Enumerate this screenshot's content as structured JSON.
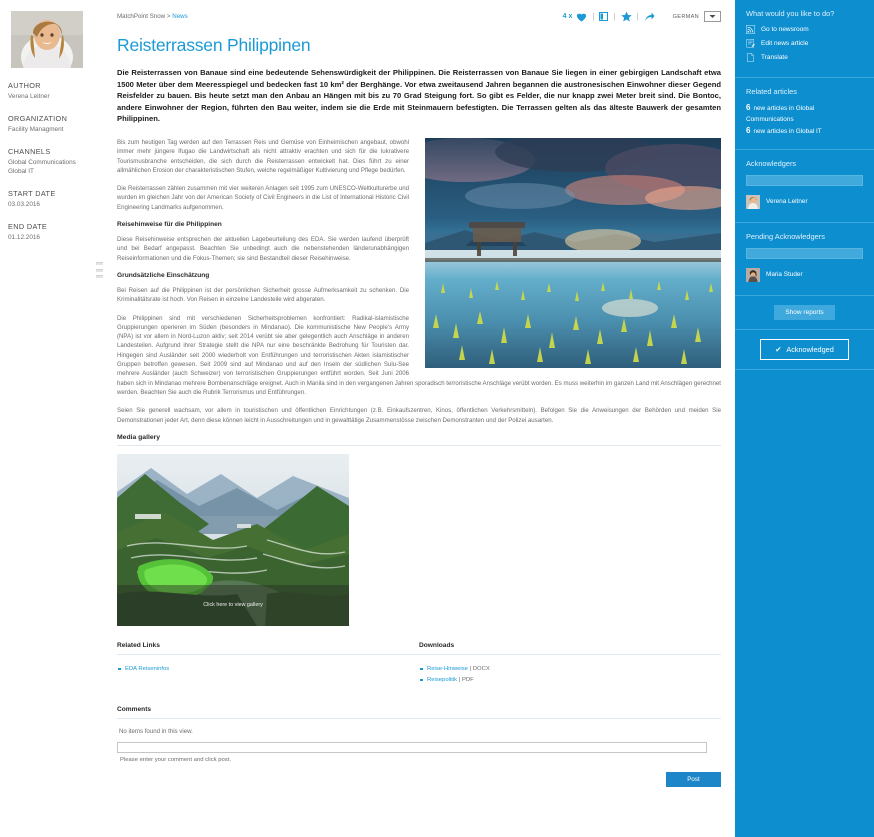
{
  "breadcrumb": {
    "root": "MatchPoint Snow",
    "separator": ">",
    "current": "News"
  },
  "toolbar": {
    "like_count": "4 x",
    "heart_icon": "heart-icon",
    "panel_icon": "panel-icon",
    "star_icon": "star-icon",
    "share_icon": "share-arrow-icon",
    "language_label": "GERMAN",
    "language_selected": "GERMAN"
  },
  "article": {
    "title": "Reisterrassen Philippinen",
    "lead": "Die Reisterrassen von Banaue sind eine bedeutende Sehenswürdigkeit der Philippinen. Die Reisterrassen von Banaue Sie liegen in einer gebirgigen Landschaft etwa 1500 Meter über dem Meeresspiegel und bedecken fast 10 km² der Berghänge. Vor etwa zweitausend Jahren begannen die austronesischen Einwohner dieser Gegend Reisfelder zu bauen. Bis heute setzt man den Anbau an Hängen mit bis zu 70 Grad Steigung fort. So gibt es Felder, die nur knapp zwei Meter breit sind. Die Bontoc, andere Einwohner der Region, führten den Bau weiter, indem sie die Erde mit Steinmauern befestigten. Die Terrassen gelten als das älteste Bauwerk der gesamten Philippinen.",
    "paragraphs": [
      "Bis zum heutigen Tag werden auf den Terrassen Reis und Gemüse von Einheimischen angebaut, obwohl immer mehr jüngere Ifugao die Landwirtschaft als nicht attraktiv erachten und sich für die lukrativere Tourismusbranche entscheiden, die sich durch die Reisterrassen entwickelt hat. Dies führt zu einer allmählichen Erosion der charakteristischen Stufen, welche regelmäßiger Kultivierung und Pflege bedürfen.",
      "Die Reisterrassen zählen zusammen mit vier weiteren Anlagen seit 1995 zum UNESCO-Weltkulturerbe und wurden im gleichen Jahr von der American Society of Civil Engineers in die List of International Historic Civil Engineering Landmarks aufgenommen."
    ],
    "heading_travel": "Reisehinweise für die Philippinen",
    "paragraph_travel": "Diese Reisehinweise entsprechen der aktuellen Lagebeurteilung des EDA. Sie werden laufend überprüft und bei Bedarf angepasst. Beachten Sie unbedingt auch die nebenstehenden länderunabhängigen Reiseinformationen und die Fokus-Themen; sie sind Bestandteil dieser Reisehinweise.",
    "heading_assessment": "Grundsätzliche Einschätzung",
    "paragraph_assessment": "Bei Reisen auf die Philippinen ist der persönlichen Sicherheit grosse Aufmerksamkeit zu schenken. Die Kriminalitätsrate ist hoch. Von Reisen in einzelne Landesteile wird abgeraten.",
    "paragraph_security": "Die Philippinen sind mit verschiedenen Sicherheitsproblemen konfrontiert: Radikal-islamistische Gruppierungen operieren im Süden (besonders in Mindanao). Die kommunistische New People's Army (NPA) ist vor allem in Nord-Luzon aktiv; seit 2014 verübt sie aber gelegentlich auch Anschläge in anderen Landesteilen. Aufgrund ihrer Strategie stellt die NPA nur eine beschränkte Bedrohung für Touristen dar. Hingegen sind Ausländer seit 2000 wiederholt von Entführungen und terroristischen Akten islamistischer Gruppen betroffen gewesen. Seit 2009 sind auf Mindanao und auf den Inseln der südlichen Sulu-See mehrere Ausländer (auch Schweizer) von terroristischen Gruppierungen entführt worden. Seit Juni 2006 haben sich in Mindanao mehrere Bombenanschläge ereignet. Auch in Manila sind in den vergangenen Jahren sporadisch terroristische Anschläge verübt worden. Es muss weiterhin im ganzen Land mit Anschlägen gerechnet werden. Beachten Sie auch die Rubrik Terrorismus und Entführungen.",
    "paragraph_final": "Seien Sie generell wachsam, vor allem in touristischen und öffentlichen Einrichtungen (z.B. Einkaufszentren, Kinos, öffentlichen Verkehrsmitteln). Befolgen Sie die Anweisungen der Behörden und meiden Sie Demonstrationen jeder Art, denn diese können leicht in Ausschreitungen und in gewalttätige Zusammenstösse zwischen Demonstranten und der Polizei ausarten."
  },
  "meta": {
    "author_label": "AUTHOR",
    "author_value": "Verena Leitner",
    "organization_label": "ORGANIZATION",
    "organization_value": "Facility Managment",
    "channels_label": "CHANNELS",
    "channels_values": [
      "Global Communications",
      "Global IT"
    ],
    "start_date_label": "START DATE",
    "start_date_value": "03.03.2016",
    "end_date_label": "END DATE",
    "end_date_value": "01.12.2016"
  },
  "gallery": {
    "heading": "Media gallery",
    "caption": "Click here to view gallery"
  },
  "related_links": {
    "heading": "Related Links",
    "items": [
      {
        "label": "EDA Reiseninfos"
      }
    ]
  },
  "downloads": {
    "heading": "Downloads",
    "items": [
      {
        "label": "Reise-Hinweise",
        "sep": " | ",
        "type": "DOCX"
      },
      {
        "label": "Reisepolitik",
        "sep": " | ",
        "type": "PDF"
      }
    ]
  },
  "comments": {
    "heading": "Comments",
    "empty_message": "No items found in this view.",
    "input_value": "",
    "input_placeholder": "",
    "hint": "Please enter your comment and click post.",
    "post_label": "Post"
  },
  "sidebar": {
    "actions_title": "What would you like to do?",
    "actions": [
      {
        "label": "Go to newsroom",
        "icon": "rss-icon"
      },
      {
        "label": "Edit news article",
        "icon": "edit-page-icon"
      },
      {
        "label": "Translate",
        "icon": "document-icon"
      }
    ],
    "related_title": "Related articles",
    "related": [
      {
        "count": "6",
        "text": "new articles in Global Communications"
      },
      {
        "count": "6",
        "text": "new articles in Global IT"
      }
    ],
    "acknowledgers_title": "Acknowledgers",
    "acknowledgers_field_value": "",
    "acknowledgers": [
      {
        "name": "Verena Leitner"
      }
    ],
    "pending_title": "Pending Acknowledgers",
    "pending_field_value": "",
    "pending": [
      {
        "name": "Maria Studer"
      }
    ],
    "show_reports_label": "Show reports",
    "acknowledged_label": "Acknowledged",
    "acknowledged_check": "✔"
  },
  "colors": {
    "accent": "#1c9ad6",
    "sidebar_bg": "#0d8ecf",
    "button_blue": "#1c86c8",
    "text_body": "#6c6c6c"
  }
}
